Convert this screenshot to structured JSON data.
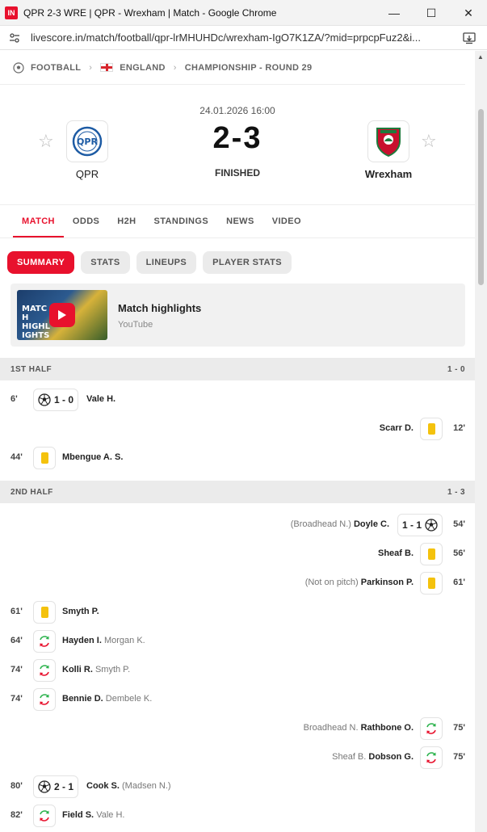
{
  "window": {
    "favicon_text": "IN",
    "title": "QPR 2-3 WRE | QPR - Wrexham | Match - Google Chrome",
    "url": "livescore.in/match/football/qpr-lrMHUHDc/wrexham-IgO7K1ZA/?mid=prpcpFuz2&i..."
  },
  "breadcrumb": {
    "sport": "FOOTBALL",
    "country": "ENGLAND",
    "league": "CHAMPIONSHIP - ROUND 29"
  },
  "match": {
    "datetime": "24.01.2026 16:00",
    "score": "2-3",
    "status": "FINISHED",
    "home": {
      "name": "QPR"
    },
    "away": {
      "name": "Wrexham"
    }
  },
  "tabs": [
    "MATCH",
    "ODDS",
    "H2H",
    "STANDINGS",
    "NEWS",
    "VIDEO"
  ],
  "subtabs": [
    "SUMMARY",
    "STATS",
    "LINEUPS",
    "PLAYER STATS"
  ],
  "video": {
    "title": "Match highlights",
    "source": "YouTube",
    "thumb_text": "MATCH HIGHLIGHTS"
  },
  "halves": [
    {
      "label": "1ST HALF",
      "score": "1 - 0",
      "events": [
        {
          "side": "home",
          "minute": "6'",
          "type": "goal",
          "score": "1 - 0",
          "player": "Vale H.",
          "extra": ""
        },
        {
          "side": "away",
          "minute": "12'",
          "type": "yellow",
          "score": "",
          "player": "Scarr D.",
          "extra": ""
        },
        {
          "side": "home",
          "minute": "44'",
          "type": "yellow",
          "score": "",
          "player": "Mbengue A. S.",
          "extra": ""
        }
      ]
    },
    {
      "label": "2ND HALF",
      "score": "1 - 3",
      "events": [
        {
          "side": "away",
          "minute": "54'",
          "type": "goal",
          "score": "1 - 1",
          "player": "Doyle C.",
          "extra": "(Broadhead N.)"
        },
        {
          "side": "away",
          "minute": "56'",
          "type": "yellow",
          "score": "",
          "player": "Sheaf B.",
          "extra": ""
        },
        {
          "side": "away",
          "minute": "61'",
          "type": "yellow",
          "score": "",
          "player": "Parkinson P.",
          "extra": "(Not on pitch)"
        },
        {
          "side": "home",
          "minute": "61'",
          "type": "yellow",
          "score": "",
          "player": "Smyth P.",
          "extra": ""
        },
        {
          "side": "home",
          "minute": "64'",
          "type": "sub",
          "score": "",
          "player": "Hayden I.",
          "extra": "Morgan K."
        },
        {
          "side": "home",
          "minute": "74'",
          "type": "sub",
          "score": "",
          "player": "Kolli R.",
          "extra": "Smyth P."
        },
        {
          "side": "home",
          "minute": "74'",
          "type": "sub",
          "score": "",
          "player": "Bennie D.",
          "extra": "Dembele K."
        },
        {
          "side": "away",
          "minute": "75'",
          "type": "sub",
          "score": "",
          "player": "Rathbone O.",
          "extra": "Broadhead N."
        },
        {
          "side": "away",
          "minute": "75'",
          "type": "sub",
          "score": "",
          "player": "Dobson G.",
          "extra": "Sheaf B."
        },
        {
          "side": "home",
          "minute": "80'",
          "type": "goal",
          "score": "2 - 1",
          "player": "Cook S.",
          "extra": "(Madsen N.)"
        },
        {
          "side": "home",
          "minute": "82'",
          "type": "sub",
          "score": "",
          "player": "Field S.",
          "extra": "Vale H."
        }
      ]
    }
  ],
  "colors": {
    "accent": "#e8112d",
    "yellow_card": "#f4c20d",
    "sub_in": "#2bb24c",
    "sub_out": "#e8112d"
  }
}
